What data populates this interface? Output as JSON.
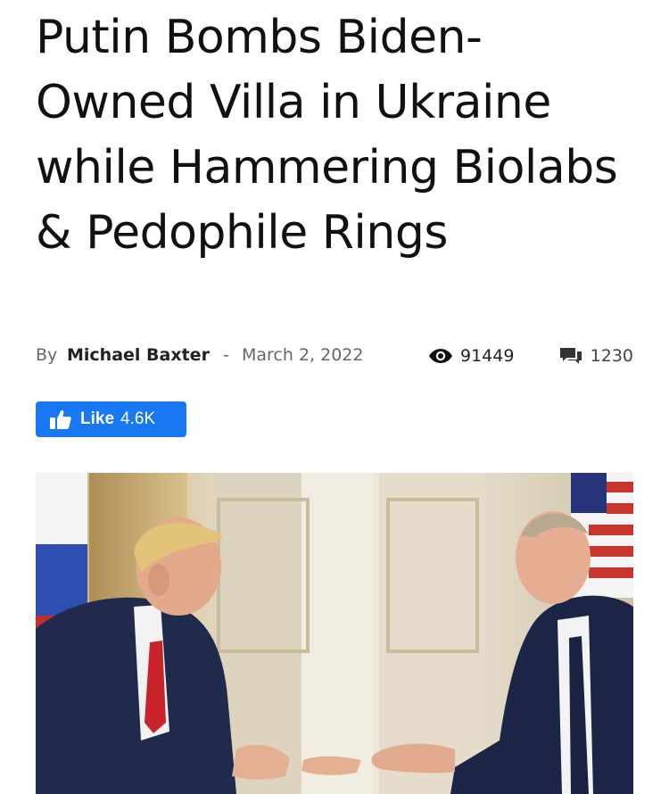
{
  "article": {
    "title": "Putin Bombs Biden-Owned Villa in Ukraine while Hammering Biolabs & Pedophile Rings",
    "by_label": "By",
    "author": "Michael Baxter",
    "separator": "-",
    "date": "March 2, 2022",
    "views": "91449",
    "comments": "1230"
  },
  "like": {
    "label": "Like",
    "count": "4.6K"
  },
  "icons": {
    "views": "eye-icon",
    "comments": "comment-bubbles-icon",
    "like": "thumbs-up-icon"
  },
  "colors": {
    "like_button": "#1877f2",
    "title_text": "#111111",
    "meta_text": "#666666"
  }
}
